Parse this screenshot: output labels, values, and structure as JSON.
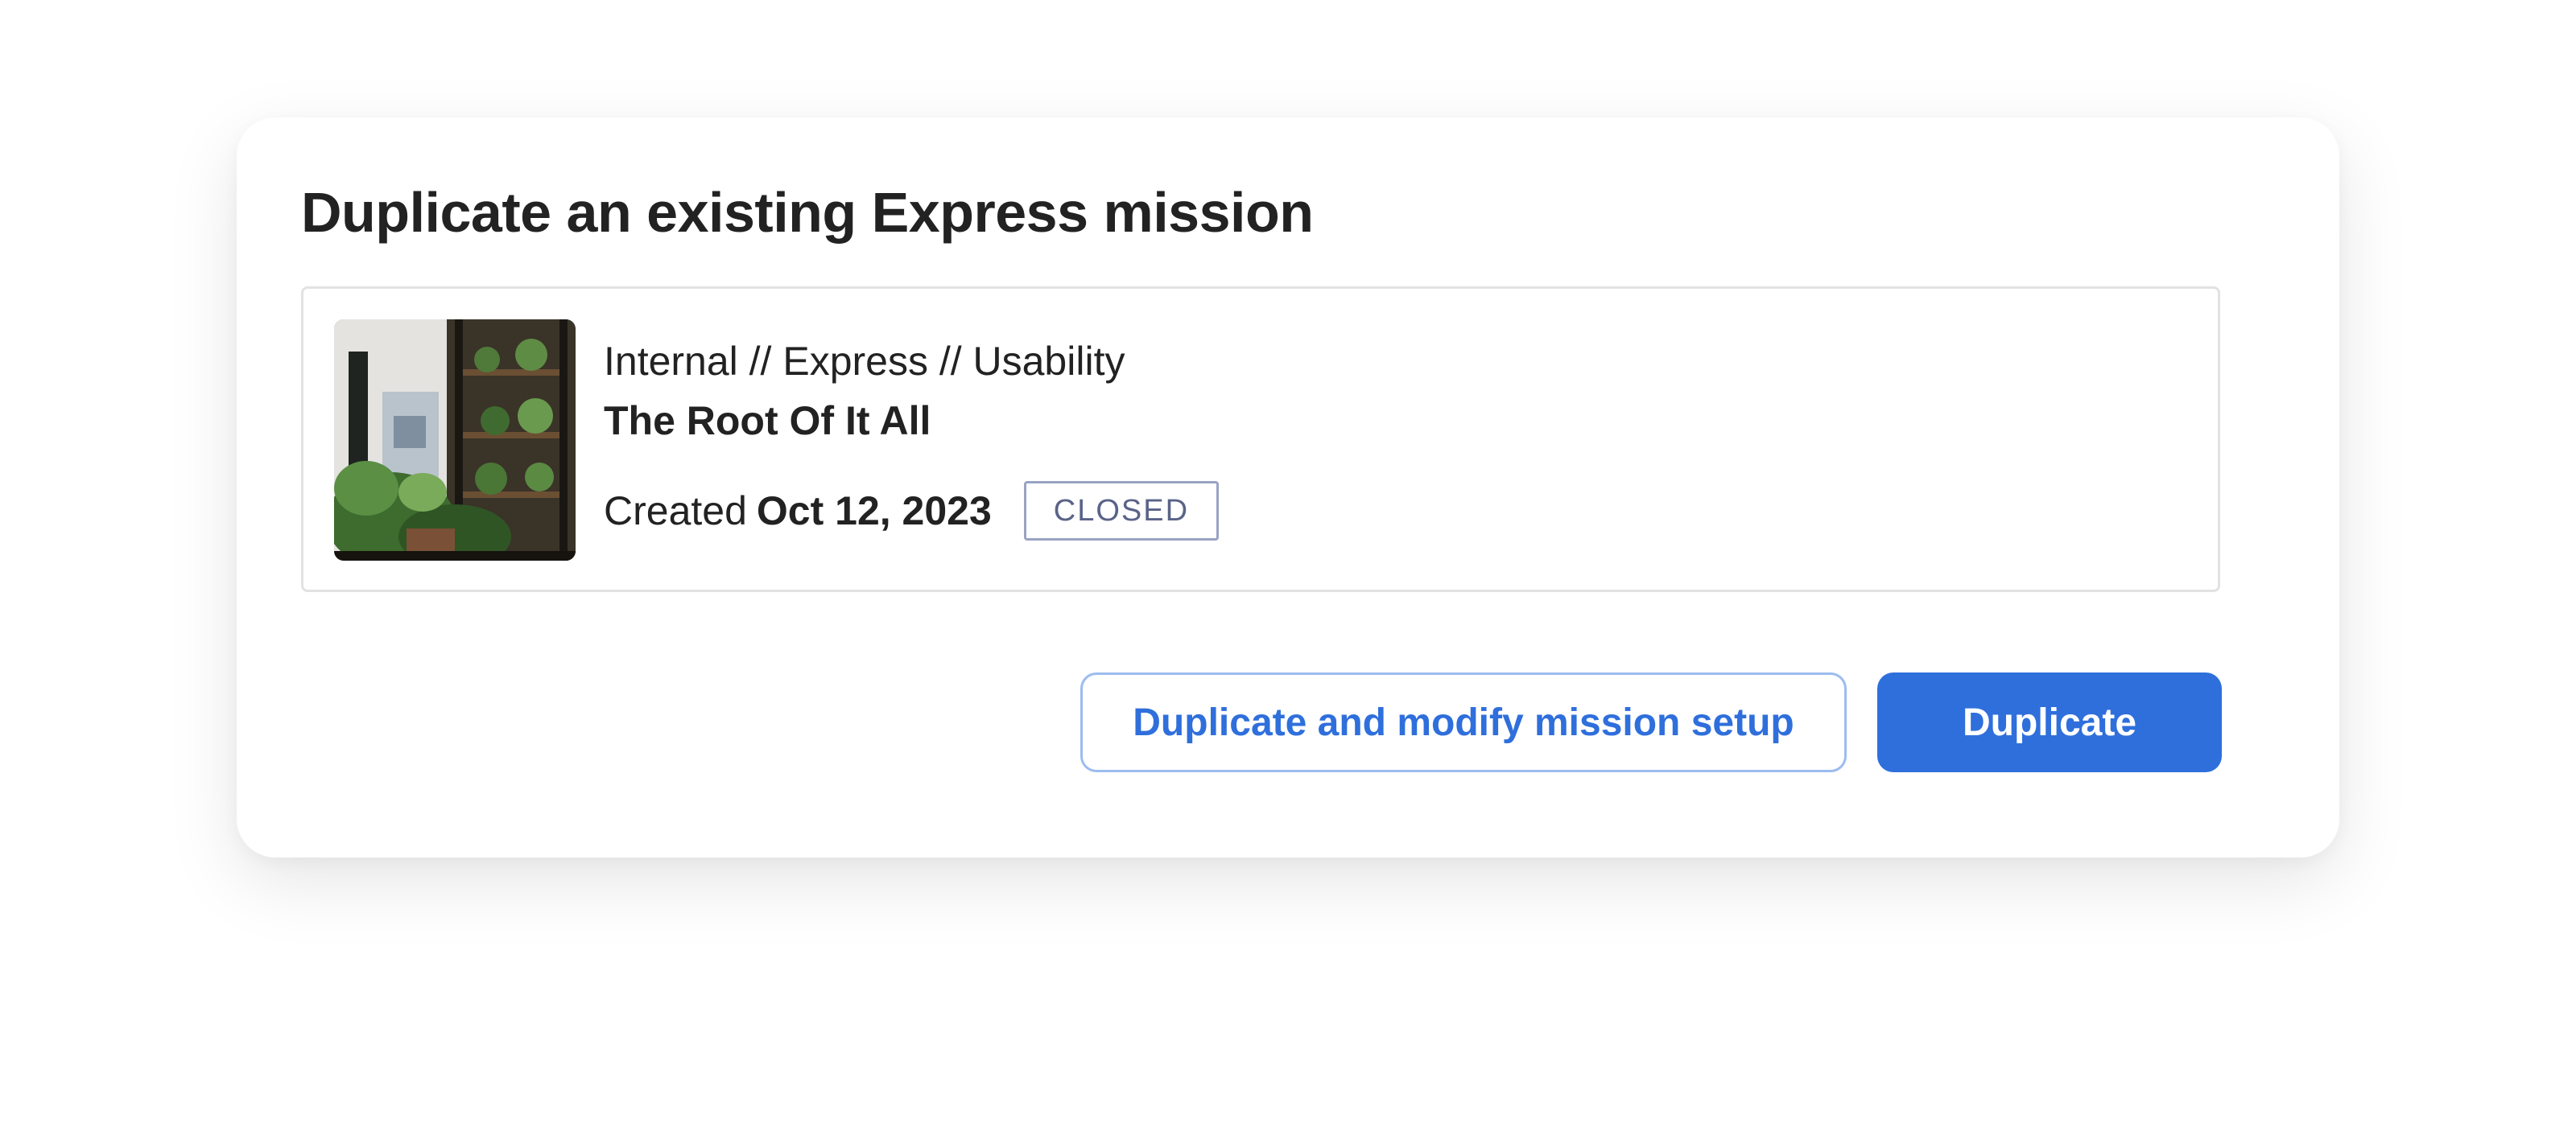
{
  "dialog": {
    "title": "Duplicate an existing Express mission"
  },
  "mission": {
    "breadcrumb": "Internal // Express // Usability",
    "name": "The Root Of It All",
    "created_prefix": "Created",
    "created_date": "Oct 12, 2023",
    "status": "CLOSED",
    "thumbnail": "plants-shop-photo"
  },
  "actions": {
    "secondary_label": "Duplicate and modify mission setup",
    "primary_label": "Duplicate"
  },
  "colors": {
    "accent": "#2f6fdc",
    "accent_border": "#9cbcf0",
    "badge_border": "#9aa3c2",
    "badge_text": "#5a6388"
  }
}
